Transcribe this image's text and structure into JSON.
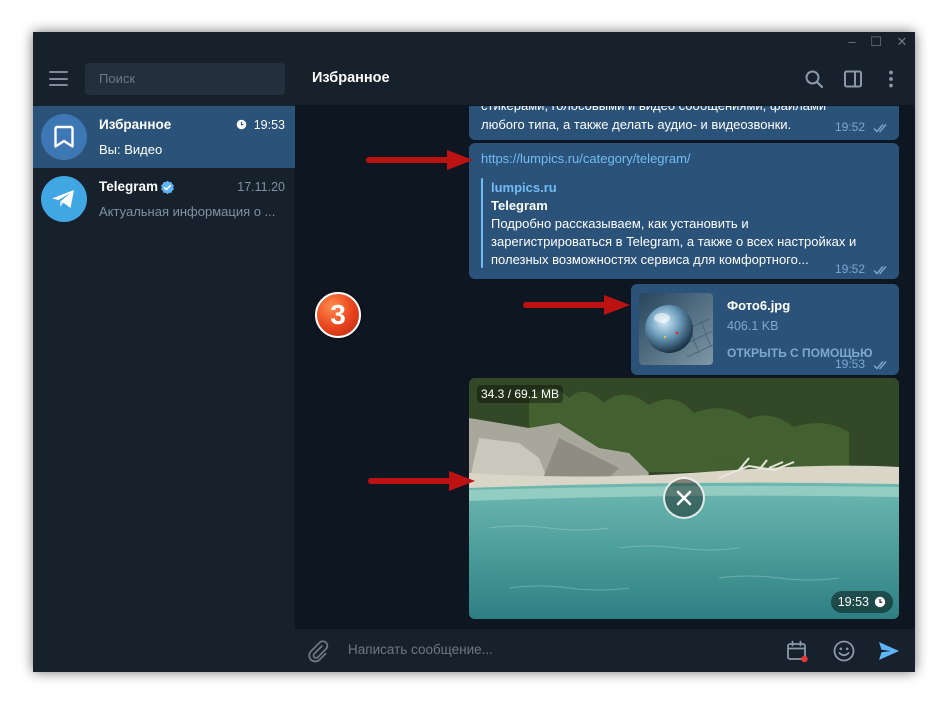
{
  "window": {
    "controls": [
      "–",
      "☐",
      "✕"
    ]
  },
  "sidebar": {
    "search_placeholder": "Поиск",
    "chats": [
      {
        "name": "Избранное",
        "time": "19:53",
        "preview": "Вы: Видео",
        "icon": "bookmark-icon",
        "active": true,
        "avatar_color": "#3d77b4"
      },
      {
        "name": "Telegram",
        "time": "17.11.20",
        "preview": "Актуальная информация о ...",
        "icon": "telegram-logo-icon",
        "verified": true,
        "avatar_color": "#40a7e3"
      }
    ]
  },
  "chat": {
    "title": "Избранное",
    "header_icons": [
      "search-icon",
      "sidebar-toggle-icon",
      "more-vertical-icon"
    ],
    "messages": {
      "text_msg": {
        "lines": [
          "стикерами, голосовыми и видео сообщениями, файлами",
          "любого типа, а также делать аудио- и видеозвонки."
        ],
        "time": "19:52"
      },
      "link_msg": {
        "url": "https://lumpics.ru/category/telegram/",
        "site": "lumpics.ru",
        "title": "Telegram",
        "description_lines": [
          "Подробно рассказываем, как установить и",
          "зарегистрироваться в Telegram, а также о всех настройках и",
          "полезных возможностях сервиса для комфортного..."
        ],
        "time": "19:52"
      },
      "file_msg": {
        "filename": "Фото6.jpg",
        "size": "406.1 KB",
        "action": "ОТКРЫТЬ С ПОМОЩЬЮ",
        "time": "19:53"
      },
      "video_msg": {
        "progress": "34.3 / 69.1 MB",
        "time": "19:53"
      }
    },
    "composer_placeholder": "Написать сообщение...",
    "composer_icons": [
      "attach-icon",
      "schedule-icon",
      "emoji-icon",
      "send-icon"
    ]
  },
  "annotation": {
    "step_number": "3",
    "arrow_color": "#d11414",
    "badge_color": "#e8411c"
  },
  "colors": {
    "bg": "#0e1621",
    "panel": "#17212b",
    "bubble": "#2b5278",
    "accent": "#5eb5f7",
    "link": "#72bcf5"
  }
}
